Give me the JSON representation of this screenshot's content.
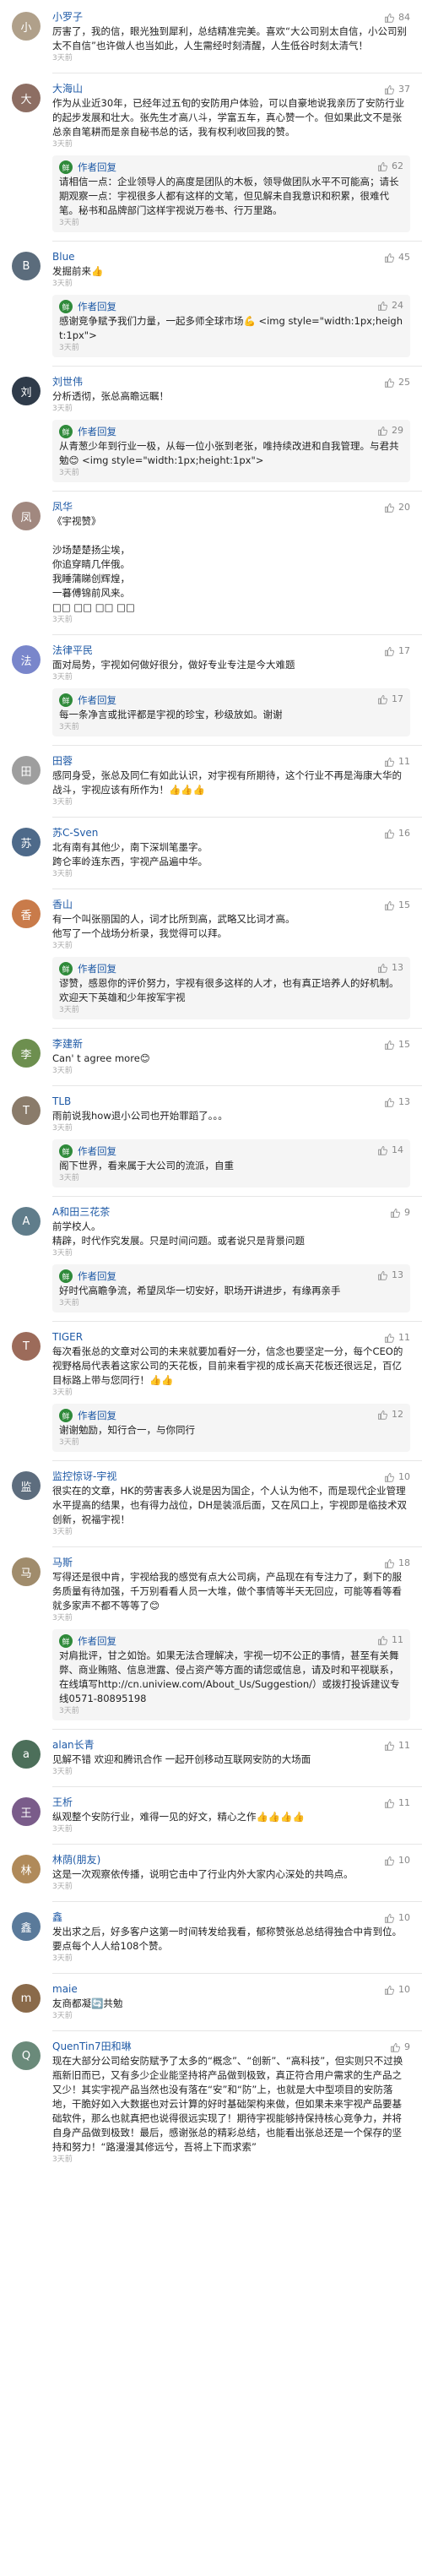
{
  "colors": {
    "author": "#1f5aa6",
    "like": "#888888",
    "reply_bg": "#f5f5f5"
  },
  "reply_avatar_char": "鲜",
  "comments": [
    {
      "author": "小罗子",
      "likes": "84",
      "text": "厉害了，我的信，眼光独到犀利，总结精准完美。喜欢“大公司别太自信，小公司别太不自信”也许做人也当如此，人生需经时刻清醒，人生低谷时刻太清气！",
      "time": "3天前"
    },
    {
      "author": "大海山",
      "likes": "37",
      "text": "作为从业近30年，已经年过五旬的安防用户体验，可以自豪地说我亲历了安防行业的起步发展和壮大。张先生才高八斗，学富五车，真心赞一个。但如果此文不是张总亲自笔耕而是亲自秘书总的话，我有权利收回我的赞。",
      "time": "3天前",
      "reply": {
        "name": "作者回复",
        "likes": "62",
        "text": "请相信一点：企业领导人的高度是团队的木板，领导做团队水平不可能高；请长期观察一点：宇视很多人都有这样的文笔，但见解未自我意识和积累，很难代笔。秘书和品牌部门这样宇视说万卷书、行万里路。",
        "time": "3天前"
      }
    },
    {
      "author": "Blue",
      "likes": "45",
      "text": "发掘前来👍",
      "time": "3天前",
      "reply": {
        "name": "作者回复",
        "likes": "24",
        "text": "感谢竞争赋予我们力量，一起多师全球市场💪 <img style=\"width:1px;height:1px\">",
        "time": "3天前"
      }
    },
    {
      "author": "刘世伟",
      "likes": "25",
      "text": "分析透彻，张总高瞻远瞩！",
      "time": "3天前",
      "reply": {
        "name": "作者回复",
        "likes": "29",
        "text": "从青葱少年到行业一极，从每一位小张到老张，唯持续改进和自我管理。与君共勉😊 <img style=\"width:1px;height:1px\">",
        "time": "3天前"
      }
    },
    {
      "author": "凤华",
      "likes": "20",
      "text": "《宇视赞》\n\n沙场楚楚扬尘埃，\n你追穿睛几伴俄。\n我睡蒲睇创辉煌，\n一暮傅锦前风来。\n□□ □□ □□ □□",
      "time": "3天前"
    },
    {
      "author": "法律平民",
      "likes": "17",
      "text": "面对局势，宇视如何做好很分，做好专业专注是今大难题",
      "time": "3天前",
      "reply": {
        "name": "作者回复",
        "likes": "17",
        "text": "每一条净言或批评都是宇视的珍宝，秒级放如。谢谢",
        "time": "3天前"
      }
    },
    {
      "author": "田蓉",
      "likes": "11",
      "text": "感同身受，张总及同仁有如此认识，对宇视有所期待，这个行业不再是海康大华的战斗，宇视应该有所作为！👍👍👍",
      "time": "3天前"
    },
    {
      "author": "苏C-Sven",
      "likes": "16",
      "text": "北有南有其他少，南下深圳笔墨字。\n跨仑率岭连东西，宇视产品遍中华。",
      "time": "3天前"
    },
    {
      "author": "香山",
      "likes": "15",
      "text": "有一个叫张丽国的人，词才比所到高，武略又比词才高。\n他写了一个战场分析录，我觉得可以拜。",
      "time": "3天前",
      "reply": {
        "name": "作者回复",
        "likes": "13",
        "text": "谬赞，感恩你的评价努力，宇视有很多这样的人才，也有真正培养人的好机制。欢迎天下英雄和少年按军宇视",
        "time": "3天前"
      }
    },
    {
      "author": "李建新",
      "likes": "15",
      "text": "Can' t agree more😊",
      "time": "3天前"
    },
    {
      "author": "TLB",
      "likes": "13",
      "text": "雨前说我how退小公司也开始罪蹈了。。。",
      "time": "3天前",
      "reply": {
        "name": "作者回复",
        "likes": "14",
        "text": "阁下世界，看来属于大公司的流派，自重",
        "time": "3天前"
      }
    },
    {
      "author": "A和田三花茶",
      "likes": "9",
      "text": "前学校人。\n精辟，时代作究发展。只是时间问题。或者说只是背景问题",
      "time": "3天前",
      "reply": {
        "name": "作者回复",
        "likes": "13",
        "text": "好时代高瞻争流，希望凤华一切安好，职场开讲进步，有缘再亲手",
        "time": "3天前"
      }
    },
    {
      "author": "TIGER",
      "likes": "11",
      "text": "每次看张总的文章对公司的未来就要加看好一分，信念也要坚定一分，每个CEO的视野格局代表着这家公司的天花板，目前来看宇视的成长高天花板还很远足，百亿目标路上带与您同行！👍👍",
      "time": "3天前",
      "reply": {
        "name": "作者回复",
        "likes": "12",
        "text": "谢谢勉励，知行合一，与你同行",
        "time": "3天前"
      }
    },
    {
      "author": "监控惊讶-宇视",
      "likes": "10",
      "text": "很实在的文章，HK的劳害表多人说是因为国企，个人认为他不，而是现代企业管理水平提高的结果，也有得力战位，DH是装派后面，又在风口上，宇视即是临技术双创新，祝福宇视！",
      "time": "3天前"
    },
    {
      "author": "马斯",
      "likes": "18",
      "text": "写得还是很中肯，宇视给我的感觉有点大公司病，产品现在有专注力了，剩下的服务质量有待加强，千万别看看人员一大堆，做个事情等半天无回应，可能等看等看就多家声不都不等等了😊",
      "time": "3天前",
      "reply": {
        "name": "作者回复",
        "likes": "11",
        "text": "对肩批评，甘之如饴。如果无法合理解决，宇视一切不公正的事情，甚至有关舞弊、商业贿赂、信息泄露、侵占资产等方面的请您或信息，请及时和平视联系，在线填写http://cn.uniview.com/About_Us/Suggestion/）或拨打投诉建议专线0571-80895198",
        "time": "3天前"
      }
    },
    {
      "author": "alan长青",
      "likes": "11",
      "text": "见解不错 欢迎和腾讯合作 一起开创移动互联网安防的大场面",
      "time": "3天前"
    },
    {
      "author": "王析",
      "likes": "11",
      "text": "纵观整个安防行业，难得一见的好文，精心之作👍👍👍👍",
      "time": "3天前"
    },
    {
      "author": "林荫(朋友)",
      "likes": "10",
      "text": "这是一次观察依传播，说明它击中了行业内外大家内心深处的共鸣点。",
      "time": "3天前"
    },
    {
      "author": "鑫",
      "likes": "10",
      "text": "发出求之后，好多客户这第一时间转发给我看，郁称赞张总总结得独合中肯到位。要点每个人人给108个赞。",
      "time": "3天前"
    },
    {
      "author": "maie",
      "likes": "10",
      "text": "友商都凝🔄共勉",
      "time": "3天前"
    },
    {
      "author": "QuenTin7田和琳",
      "likes": "9",
      "text": "现在大部分公司给安防赋予了太多的“概念”、“创新”、“高科技”，但实则只不过换瓶新旧而已，又有多少企业能坚持将产品做到极致，真正符合用户需求的生产品之又少！其实宇视产品当然也没有落在“安”和“防”上，也就是大中型项目的安防落地，干脆好如入大数据也对云计算的好时基础架构来做，但如果未来宇视产品要基础软件，那么也就真把也说得很远实现了！期待宇视能够持保持核心竞争力，并将自身产品做到极致！最后，感谢张总的精彩总结，也能看出张总还是一个保存的坚持和努力！“路漫漫其修远兮，吾将上下而求索”",
      "time": "3天前"
    }
  ]
}
